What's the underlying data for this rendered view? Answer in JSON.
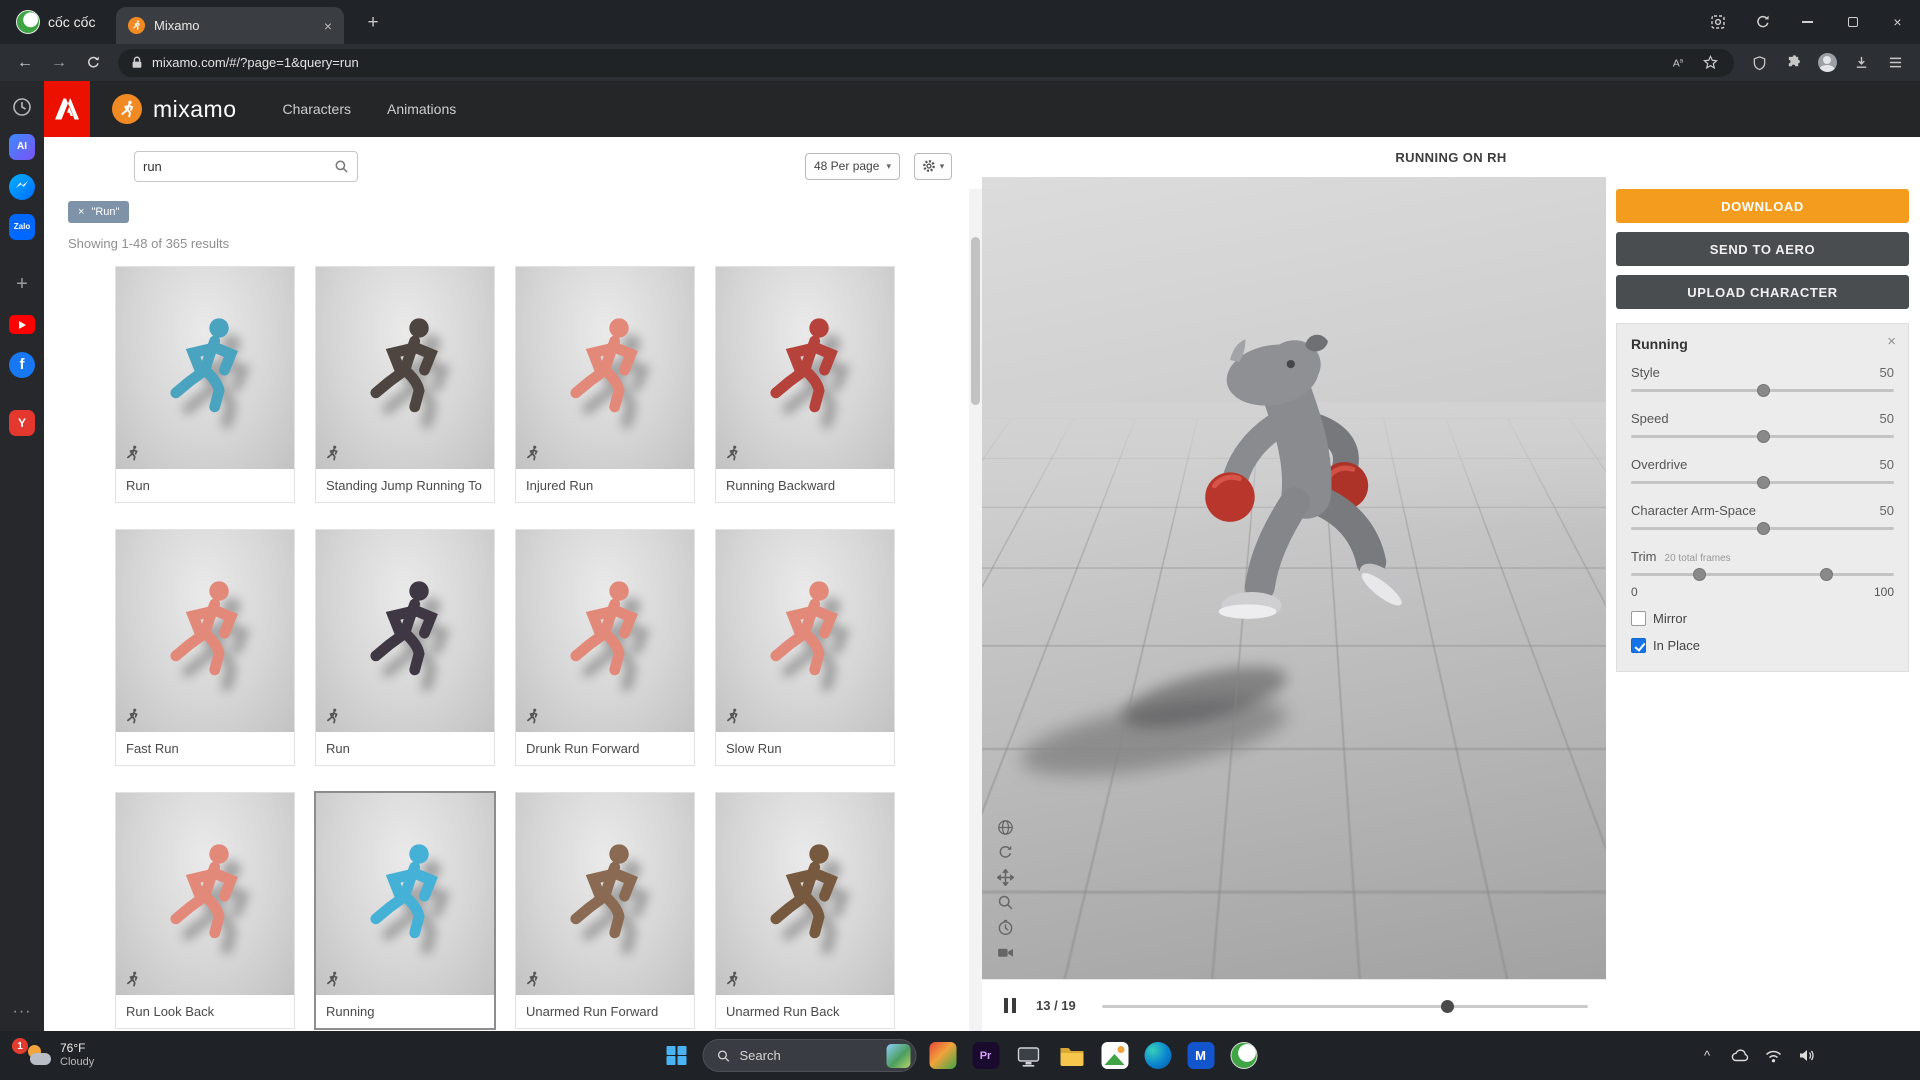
{
  "glyphs": {
    "close": "×",
    "plus": "+",
    "more": "···",
    "caret": "▾",
    "back": "←",
    "forward": "→",
    "chevron_up": "^"
  },
  "browser": {
    "brand": "cốc cốc",
    "tab_title": "Mixamo",
    "url": "mixamo.com/#/?page=1&query=run"
  },
  "dock": {
    "ai": "AI",
    "zalo": "Zalo",
    "facebook": "f",
    "red_app": "Y"
  },
  "header": {
    "logo_text": "mixamo",
    "nav": [
      {
        "label": "Characters"
      },
      {
        "label": "Animations"
      }
    ]
  },
  "toolbar": {
    "search_value": "run",
    "per_page": "48 Per page"
  },
  "results": {
    "chip_close": "×",
    "chip_label": "\"Run\"",
    "summary": "Showing 1-48 of 365 results",
    "cards": [
      {
        "label": "Run",
        "color": "#4aa3bf"
      },
      {
        "label": "Standing Jump Running To",
        "color": "#4e4440"
      },
      {
        "label": "Injured Run",
        "color": "#e2897a"
      },
      {
        "label": "Running Backward",
        "color": "#b5433c"
      },
      {
        "label": "Fast Run",
        "color": "#e2897a"
      },
      {
        "label": "Run",
        "color": "#3f3844"
      },
      {
        "label": "Drunk Run Forward",
        "color": "#e2897a"
      },
      {
        "label": "Slow Run",
        "color": "#e2897a"
      },
      {
        "label": "Run Look Back",
        "color": "#e2897a"
      },
      {
        "label": "Running",
        "color": "#45b1d6",
        "selected": true
      },
      {
        "label": "Unarmed Run Forward",
        "color": "#8a6a52"
      },
      {
        "label": "Unarmed Run Back",
        "color": "#77593f"
      }
    ]
  },
  "preview": {
    "title": "RUNNING ON RH",
    "frame_label": "13 / 19"
  },
  "panel": {
    "download_label": "DOWNLOAD",
    "aero_label": "SEND TO AERO",
    "upload_label": "UPLOAD CHARACTER",
    "title": "Running",
    "sliders": [
      {
        "label": "Style",
        "value": "50"
      },
      {
        "label": "Speed",
        "value": "50"
      },
      {
        "label": "Overdrive",
        "value": "50"
      },
      {
        "label": "Character Arm-Space",
        "value": "50"
      }
    ],
    "trim": {
      "label": "Trim",
      "note": "20 total frames",
      "min": "0",
      "max": "100"
    },
    "mirror": {
      "label": "Mirror",
      "checked": false
    },
    "in_place": {
      "label": "In Place",
      "checked": true
    }
  },
  "taskbar": {
    "badge": "1",
    "weather_temp": "76°F",
    "weather_cond": "Cloudy",
    "search_label": "Search",
    "apps": {
      "premiere": "Pr",
      "mail": "M"
    }
  }
}
